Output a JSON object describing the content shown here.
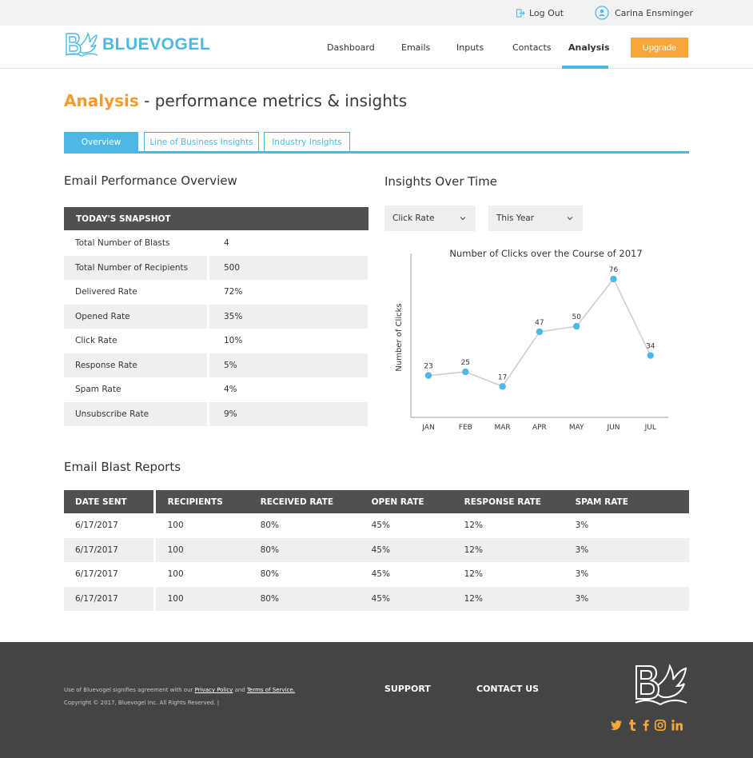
{
  "topbar": {
    "logout_label": "Log Out",
    "user_name": "Carina Ensminger"
  },
  "brand": {
    "name": "BLUEVOGEL",
    "accent_color": "#4db8e3",
    "orange_color": "#f8a53a"
  },
  "nav": {
    "items": [
      "Dashboard",
      "Emails",
      "Inputs",
      "Contacts",
      "Analysis"
    ],
    "active": "Analysis",
    "upgrade_label": "Upgrade"
  },
  "page": {
    "title_accent": "Analysis",
    "title_rest": " - performance metrics & insights"
  },
  "tabs": [
    "Overview",
    "Line of Business Insights",
    "Industry Insights"
  ],
  "overview": {
    "heading": "Email Performance Overview",
    "snapshot_title": "TODAY'S SNAPSHOT",
    "rows": [
      {
        "label": "Total Number of Blasts",
        "value": "4"
      },
      {
        "label": "Total Number of Recipients",
        "value": "500"
      },
      {
        "label": "Delivered Rate",
        "value": "72%"
      },
      {
        "label": "Opened Rate",
        "value": "35%"
      },
      {
        "label": "Click Rate",
        "value": "10%"
      },
      {
        "label": "Response Rate",
        "value": "5%"
      },
      {
        "label": "Spam Rate",
        "value": "4%"
      },
      {
        "label": "Unsubscribe Rate",
        "value": "9%"
      }
    ]
  },
  "insights": {
    "heading": "Insights Over Time",
    "metric_select": "Click Rate",
    "period_select": "This Year"
  },
  "chart_data": {
    "type": "line",
    "title": "Number of Clicks over the Course of 2017",
    "xlabel": "",
    "ylabel": "Number of Clicks",
    "categories": [
      "JAN",
      "FEB",
      "MAR",
      "APR",
      "MAY",
      "JUN",
      "JUL"
    ],
    "values": [
      23,
      25,
      17,
      47,
      50,
      76,
      34
    ],
    "ylim": [
      0,
      90
    ],
    "grid": false,
    "line_color": "#cfcfcf",
    "point_color": "#4db8e3"
  },
  "reports": {
    "heading": "Email Blast Reports",
    "columns": [
      "DATE SENT",
      "RECIPIENTS",
      "RECEIVED RATE",
      "OPEN RATE",
      "RESPONSE RATE",
      "SPAM RATE"
    ],
    "rows": [
      [
        "6/17/2017",
        "100",
        "80%",
        "45%",
        "12%",
        "3%"
      ],
      [
        "6/17/2017",
        "100",
        "80%",
        "45%",
        "12%",
        "3%"
      ],
      [
        "6/17/2017",
        "100",
        "80%",
        "45%",
        "12%",
        "3%"
      ],
      [
        "6/17/2017",
        "100",
        "80%",
        "45%",
        "12%",
        "3%"
      ]
    ]
  },
  "footer": {
    "legal_prefix": "Use of Bluevogel signifies agreement with our ",
    "privacy_label": "Privacy Policy",
    "legal_and": " and ",
    "terms_label": "Terms of Service.",
    "copyright": "Copyright © 2017, Bluevogel Inc. All Rights Reserved. |",
    "support_label": "SUPPORT",
    "contact_label": "CONTACT US",
    "social": [
      "twitter-icon",
      "tumblr-icon",
      "facebook-icon",
      "instagram-icon",
      "linkedin-icon"
    ]
  }
}
